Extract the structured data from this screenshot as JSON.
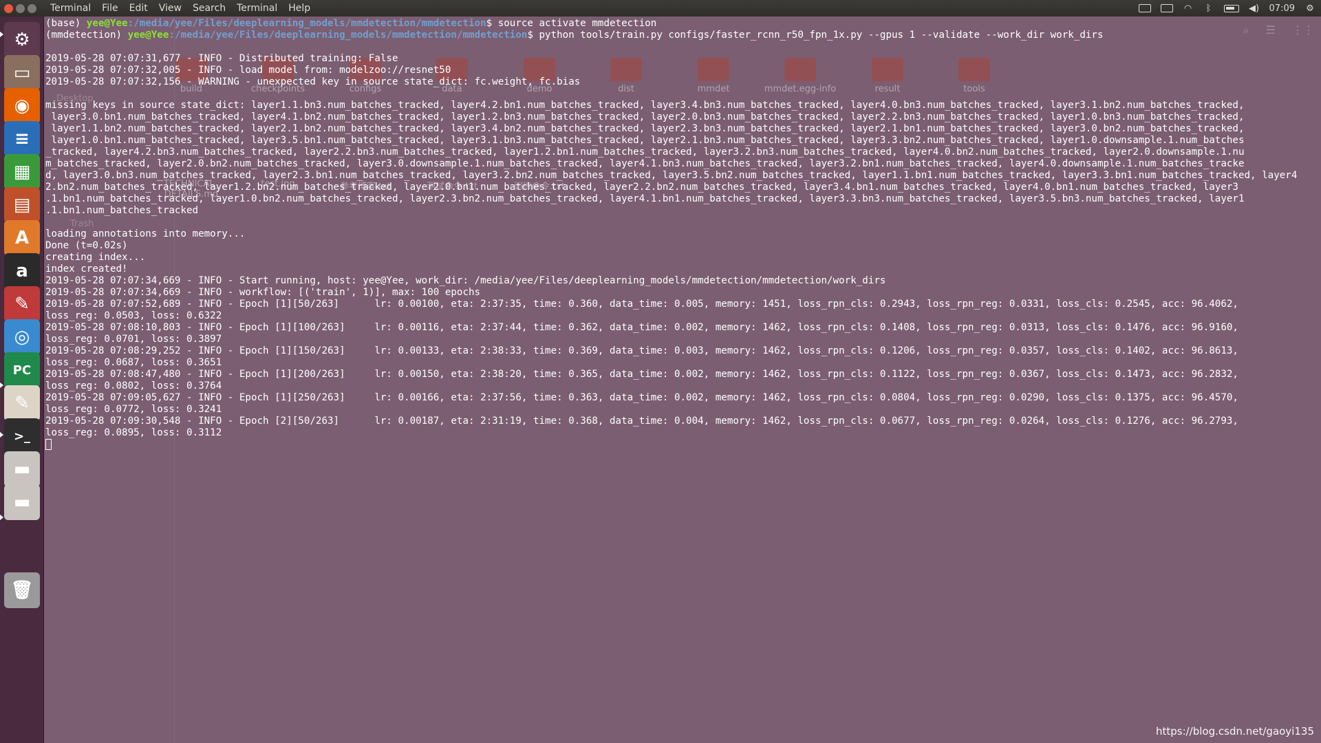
{
  "top_panel": {
    "app_name": "Terminal",
    "menus": [
      "File",
      "Edit",
      "View",
      "Search",
      "Terminal",
      "Help"
    ],
    "time": "07:09"
  },
  "launcher": {
    "items": [
      {
        "name": "dash-home-icon",
        "glyph": "⚙",
        "color": "#5e3a4f"
      },
      {
        "name": "files-icon",
        "glyph": "▭",
        "color": "#8a6e5e"
      },
      {
        "name": "firefox-icon",
        "glyph": "◉",
        "color": "#e66000"
      },
      {
        "name": "writer-icon",
        "glyph": "≡",
        "color": "#2a6eb8"
      },
      {
        "name": "calc-icon",
        "glyph": "▦",
        "color": "#3a9a3a"
      },
      {
        "name": "impress-icon",
        "glyph": "▤",
        "color": "#c0502a"
      },
      {
        "name": "software-center-icon",
        "glyph": "A",
        "color": "#e07a2a"
      },
      {
        "name": "amazon-icon",
        "glyph": "a",
        "color": "#2a2a2a"
      },
      {
        "name": "system-settings-icon",
        "glyph": "✎",
        "color": "#c03a3a"
      },
      {
        "name": "chrome-icon",
        "glyph": "◎",
        "color": "#3a8ad0"
      },
      {
        "name": "pycharm-icon",
        "glyph": "PC",
        "color": "#1f8a4a"
      },
      {
        "name": "text-editor-icon",
        "glyph": "✎",
        "color": "#ddd4c8"
      },
      {
        "name": "terminal-icon",
        "glyph": ">_",
        "color": "#2e2e2e"
      },
      {
        "name": "drive-icon",
        "glyph": "▬",
        "color": "#c9c4bf"
      },
      {
        "name": "drive-2-icon",
        "glyph": "▬",
        "color": "#c9c4bf"
      },
      {
        "name": "trash-icon",
        "glyph": "🗑",
        "color": "#9a9a9a"
      }
    ]
  },
  "terminal": {
    "prompt1": {
      "env": "(base) ",
      "user": "yee@Yee",
      "path": ":/media/yee/Files/deeplearning_models/mmdetection/mmdetection",
      "cmd": "$ source activate mmdetection"
    },
    "prompt2": {
      "env": "(mmdetection) ",
      "user": "yee@Yee",
      "path": ":/media/yee/Files/deeplearning_models/mmdetection/mmdetection",
      "cmd": "$ python tools/train.py configs/faster_rcnn_r50_fpn_1x.py --gpus 1 --validate --work_dir work_dirs"
    },
    "lines": [
      "",
      "2019-05-28 07:07:31,677 - INFO - Distributed training: False",
      "2019-05-28 07:07:32,005 - INFO - load model from: modelzoo://resnet50",
      "2019-05-28 07:07:32,156 - WARNING - unexpected key in source state_dict: fc.weight, fc.bias",
      "",
      "missing keys in source state_dict: layer1.1.bn3.num_batches_tracked, layer4.2.bn1.num_batches_tracked, layer3.4.bn3.num_batches_tracked, layer4.0.bn3.num_batches_tracked, layer3.1.bn2.num_batches_tracked,",
      " layer3.0.bn1.num_batches_tracked, layer4.1.bn2.num_batches_tracked, layer1.2.bn3.num_batches_tracked, layer2.0.bn3.num_batches_tracked, layer2.2.bn3.num_batches_tracked, layer1.0.bn3.num_batches_tracked,",
      " layer1.1.bn2.num_batches_tracked, layer2.1.bn2.num_batches_tracked, layer3.4.bn2.num_batches_tracked, layer2.3.bn3.num_batches_tracked, layer2.1.bn1.num_batches_tracked, layer3.0.bn2.num_batches_tracked,",
      " layer1.0.bn1.num_batches_tracked, layer3.5.bn1.num_batches_tracked, layer3.1.bn3.num_batches_tracked, layer2.1.bn3.num_batches_tracked, layer3.3.bn2.num_batches_tracked, layer1.0.downsample.1.num_batches",
      "_tracked, layer4.2.bn3.num_batches_tracked, layer2.2.bn3.num_batches_tracked, layer1.2.bn1.num_batches_tracked, layer3.2.bn3.num_batches_tracked, layer4.0.bn2.num_batches_tracked, layer2.0.downsample.1.nu",
      "m_batches_tracked, layer2.0.bn2.num_batches_tracked, layer3.0.downsample.1.num_batches_tracked, layer4.1.bn3.num_batches_tracked, layer3.2.bn1.num_batches_tracked, layer4.0.downsample.1.num_batches_tracke",
      "d, layer3.0.bn3.num_batches_tracked, layer2.3.bn1.num_batches_tracked, layer3.2.bn2.num_batches_tracked, layer3.5.bn2.num_batches_tracked, layer1.1.bn1.num_batches_tracked, layer3.3.bn1.num_batches_tracked, layer4",
      "2.bn2.num_batches_tracked, layer1.2.bn2.num_batches_tracked, layer2.0.bn1.num_batches_tracked, layer2.2.bn2.num_batches_tracked, layer3.4.bn1.num_batches_tracked, layer4.0.bn1.num_batches_tracked, layer3",
      ".1.bn1.num_batches_tracked, layer1.0.bn2.num_batches_tracked, layer2.3.bn2.num_batches_tracked, layer4.1.bn1.num_batches_tracked, layer3.3.bn3.num_batches_tracked, layer3.5.bn3.num_batches_tracked, layer1",
      ".1.bn1.num_batches_tracked",
      "",
      "loading annotations into memory...",
      "Done (t=0.02s)",
      "creating index...",
      "index created!",
      "2019-05-28 07:07:34,669 - INFO - Start running, host: yee@Yee, work_dir: /media/yee/Files/deeplearning_models/mmdetection/mmdetection/work_dirs",
      "2019-05-28 07:07:34,669 - INFO - workflow: [('train', 1)], max: 100 epochs",
      "2019-05-28 07:07:52,689 - INFO - Epoch [1][50/263]      lr: 0.00100, eta: 2:37:35, time: 0.360, data_time: 0.005, memory: 1451, loss_rpn_cls: 0.2943, loss_rpn_reg: 0.0331, loss_cls: 0.2545, acc: 96.4062,",
      "loss_reg: 0.0503, loss: 0.6322",
      "2019-05-28 07:08:10,803 - INFO - Epoch [1][100/263]     lr: 0.00116, eta: 2:37:44, time: 0.362, data_time: 0.002, memory: 1462, loss_rpn_cls: 0.1408, loss_rpn_reg: 0.0313, loss_cls: 0.1476, acc: 96.9160,",
      "loss_reg: 0.0701, loss: 0.3897",
      "2019-05-28 07:08:29,252 - INFO - Epoch [1][150/263]     lr: 0.00133, eta: 2:38:33, time: 0.369, data_time: 0.003, memory: 1462, loss_rpn_cls: 0.1206, loss_rpn_reg: 0.0357, loss_cls: 0.1402, acc: 96.8613,",
      "loss_reg: 0.0687, loss: 0.3651",
      "2019-05-28 07:08:47,480 - INFO - Epoch [1][200/263]     lr: 0.00150, eta: 2:38:20, time: 0.365, data_time: 0.002, memory: 1462, loss_rpn_cls: 0.1122, loss_rpn_reg: 0.0367, loss_cls: 0.1473, acc: 96.2832,",
      "loss_reg: 0.0802, loss: 0.3764",
      "2019-05-28 07:09:05,627 - INFO - Epoch [1][250/263]     lr: 0.00166, eta: 2:37:56, time: 0.363, data_time: 0.002, memory: 1462, loss_rpn_cls: 0.0804, loss_rpn_reg: 0.0290, loss_cls: 0.1375, acc: 96.4570,",
      "loss_reg: 0.0772, loss: 0.3241",
      "2019-05-28 07:09:30,548 - INFO - Epoch [2][50/263]      lr: 0.00187, eta: 2:31:19, time: 0.368, data_time: 0.004, memory: 1462, loss_rpn_cls: 0.0677, loss_rpn_reg: 0.0264, loss_cls: 0.1276, acc: 96.2793,",
      "loss_reg: 0.0895, loss: 0.3112"
    ]
  },
  "background_files": {
    "folders": [
      "build",
      "checkpoints",
      "configs",
      "data",
      "demo",
      "dist",
      "mmdet",
      "mmdet.egg-info",
      "result",
      "tools"
    ],
    "files": [
      "TECHNICAL_\nDETAILS.md",
      "test.jpg",
      "参考博客.txt",
      "测试命令.txt",
      "训练命令.txt"
    ],
    "sidebar": [
      "Desktop",
      "Trash"
    ]
  },
  "watermark": "https://blog.csdn.net/gaoyi135"
}
